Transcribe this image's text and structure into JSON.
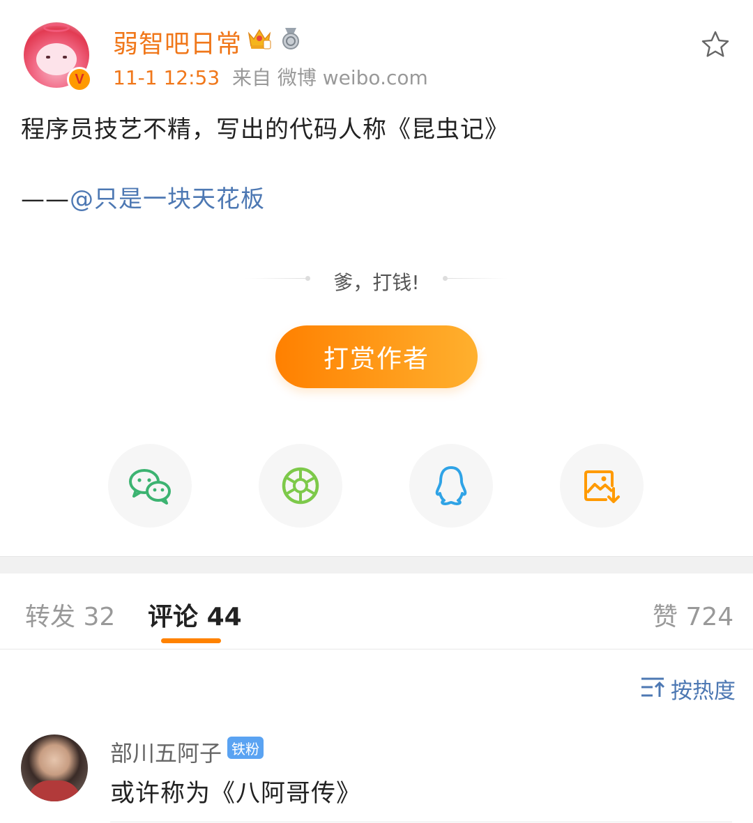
{
  "post": {
    "username": "弱智吧日常",
    "badge_v": "V",
    "time": "11-1 12:53",
    "source": "来自 微博 weibo.com",
    "text": "程序员技艺不精，写出的代码人称《昆虫记》",
    "credit_prefix": "——",
    "credit_mention": "@只是一块天花板"
  },
  "reward": {
    "slogan": "爹，打钱!",
    "button_label": "打赏作者"
  },
  "share": {
    "icons": [
      "wechat-icon",
      "moments-icon",
      "qq-icon",
      "save-image-icon"
    ],
    "colors": {
      "wechat": "#3cb371",
      "moments": "#7dc94a",
      "qq": "#2fa3e6",
      "save": "#ff9a00"
    }
  },
  "tabs": {
    "repost_label": "转发",
    "repost_count": "32",
    "comment_label": "评论",
    "comment_count": "44",
    "like_label": "赞",
    "like_count": "724"
  },
  "sort": {
    "label": "按热度"
  },
  "comments": [
    {
      "user": "部川五阿子",
      "badge": "铁粉",
      "text": "或许称为《八阿哥传》"
    }
  ],
  "colors": {
    "accent": "#f0771a",
    "link": "#4d78b3",
    "reward_gradient_start": "#ff8000",
    "reward_gradient_end": "#ffb02e",
    "tab_indicator": "#ff8200"
  }
}
